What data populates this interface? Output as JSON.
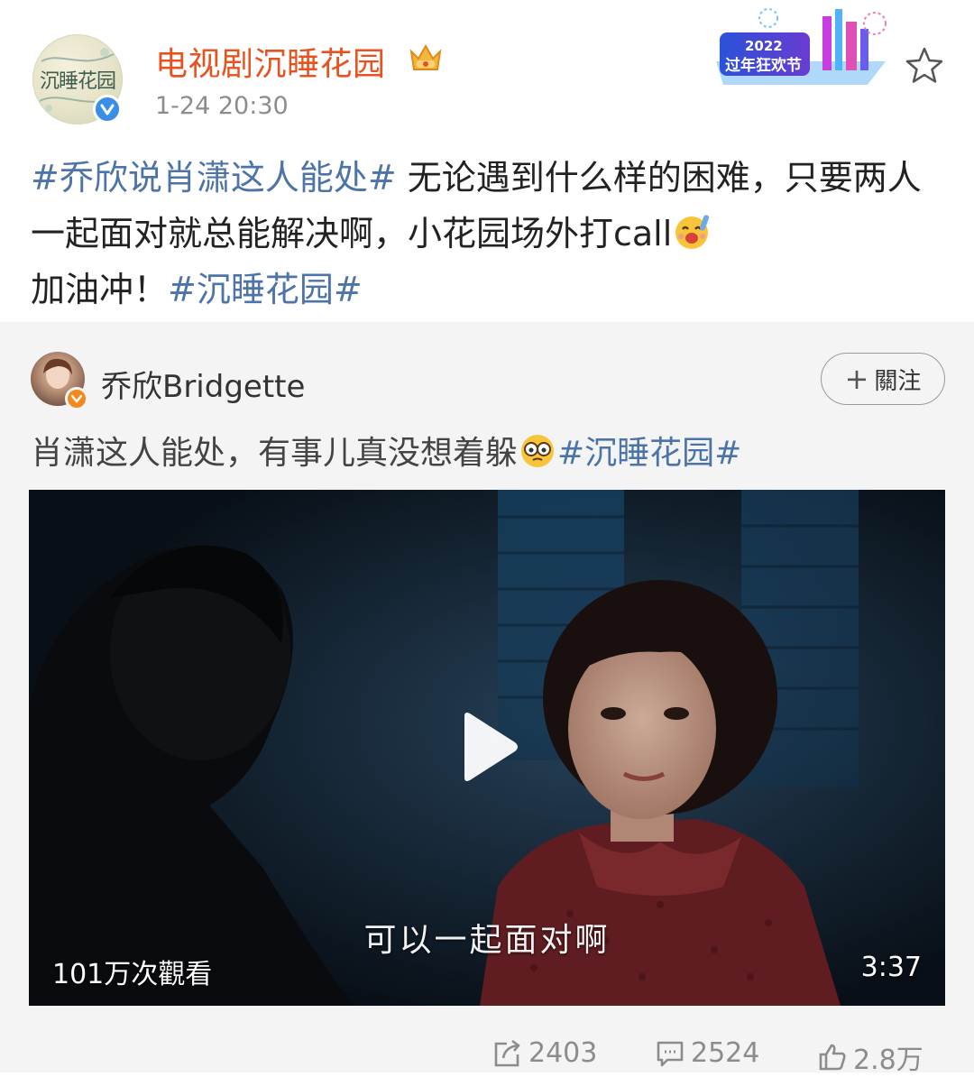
{
  "header": {
    "account_name": "电视剧沉睡花园",
    "timestamp": "1-24 20:30",
    "avatar_text": "沉睡花园",
    "banner_year": "2022",
    "banner_text": "过年狂欢节",
    "icons": [
      "crown-icon",
      "verified-icon",
      "star-icon"
    ]
  },
  "post": {
    "hashtag1": "#乔欣说肖潇这人能处#",
    "text1": " 无论遇到什么样的困难，只要两人一起面对就总能解决啊，小花园场外打call",
    "text2": "加油冲！",
    "hashtag2": "#沉睡花园#"
  },
  "repost": {
    "author": "乔欣Bridgette",
    "follow_label": "關注",
    "follow_plus": "+",
    "text": "肖潇这人能处，有事儿真没想着躲",
    "hashtag": "#沉睡花园#",
    "video": {
      "subtitle": "可以一起面对啊",
      "views": "101万次觀看",
      "duration": "3:37"
    }
  },
  "actions": {
    "reposts": "2403",
    "comments": "2524",
    "likes": "2.8万"
  },
  "colors": {
    "name": "#e8521e",
    "hashtag": "#4d74a8",
    "verified_blue": "#3a8ee6",
    "verified_orange": "#f08a1e",
    "muted": "#8c8c8c"
  }
}
